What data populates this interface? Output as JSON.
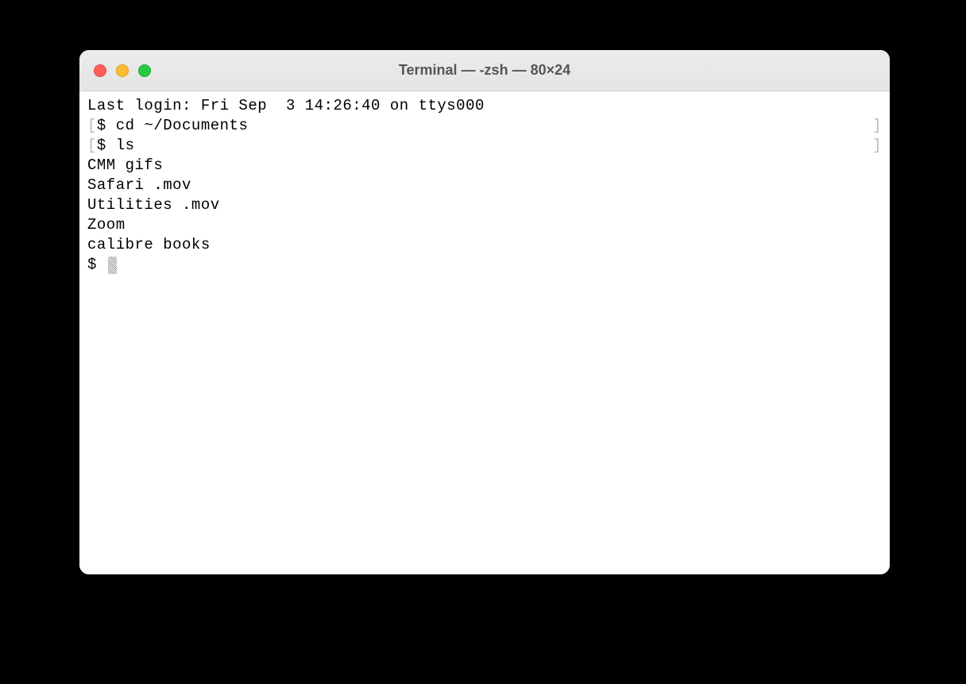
{
  "window": {
    "title": "Terminal — -zsh — 80×24"
  },
  "terminal": {
    "last_login": "Last login: Fri Sep  3 14:26:40 on ttys000",
    "cmd1_prompt": "$ ",
    "cmd1": "cd ~/Documents",
    "cmd2_prompt": "$ ",
    "cmd2": "ls",
    "out1": "CMM gifs",
    "out2": "Safari .mov",
    "out3": "Utilities .mov",
    "out4": "Zoom",
    "out5": "calibre books",
    "prompt_cur": "$ "
  }
}
